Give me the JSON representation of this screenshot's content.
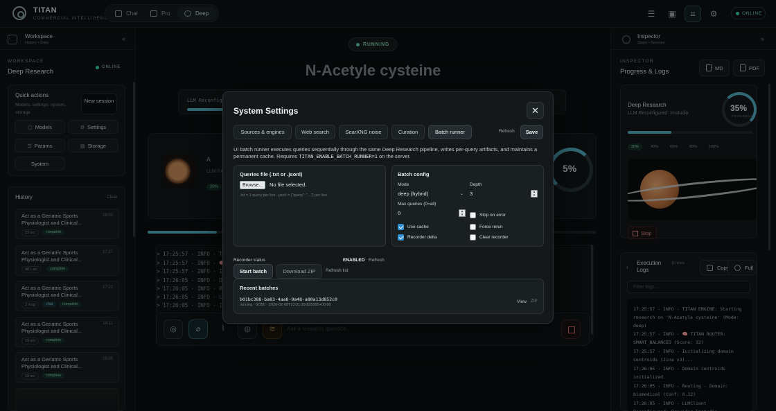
{
  "topbar": {
    "brand": "TITAN",
    "brand_sub": "COMMERCIAL INTELLIGENCE",
    "modes": [
      "Chat",
      "Pro",
      "Deep"
    ],
    "status": "ONLINE"
  },
  "workspace": {
    "title": "Workspace",
    "sub": "History • Data",
    "label": "WORKSPACE",
    "name": "Deep Research",
    "status": "ONLINE",
    "quick_actions": {
      "title": "Quick actions",
      "sub": "Models, settings, system, storage",
      "new_session": "New session",
      "buttons": [
        "Models",
        "Settings",
        "Params",
        "Storage",
        "System"
      ]
    },
    "history": {
      "title": "History",
      "clear": "Clear",
      "items": [
        {
          "title": "Act as a Geriatric Sports Physiologist and Clinical...",
          "time": "18:00",
          "badge": "19 src",
          "status": "complete"
        },
        {
          "title": "Act as a Geriatric Sports Physiologist and Clinical...",
          "time": "17:27",
          "badge": "481 src",
          "status": "complete"
        },
        {
          "title": "Act as a Geriatric Sports Physiologist and Clinical...",
          "time": "17:23",
          "badge": "2 msg",
          "tag": "chat",
          "status": "complete"
        },
        {
          "title": "Act as a Geriatric Sports Physiologist and Clinical...",
          "time": "16:11",
          "badge": "19 src",
          "status": "complete"
        },
        {
          "title": "Act as a Geriatric Sports Physiologist and Clinical...",
          "time": "16:05",
          "badge": "19 src",
          "status": "complete"
        }
      ]
    }
  },
  "center": {
    "status": "RUNNING",
    "title": "N-Acetyle cysteine",
    "card1_text": "LLM Reconfigured",
    "card2_title": "A",
    "card2_sub": "LLM Re",
    "card2_chip": "20%",
    "ring_pct": "5%",
    "log_lines": [
      "> 17:25:57 - INFO - TI",
      "> 17:25:57 - INFO - 🧠",
      "> 17:25:57 - INFO - In",
      "> 17:26:05 - INFO - Do",
      "> 17:26:05 - INFO - Ro",
      "> 17:26:05 - INFO - LL",
      "> 17:26:05 - INFO - [D"
    ],
    "input_placeholder": "Ask a research question..."
  },
  "inspector": {
    "title": "Inspector",
    "sub": "Steps • Sources",
    "label": "INSPECTOR",
    "name": "Progress & Logs",
    "export_md": "MD",
    "export_pdf": "PDF",
    "progress": {
      "title": "Deep Research",
      "sub": "LLM Reconfigured: Imstudio",
      "pct": "35%",
      "pct_label": "PROGRESS",
      "value": 0.35,
      "chips": [
        "20%",
        "40%",
        "60%",
        "80%",
        "100%"
      ],
      "stop": "Stop"
    },
    "exec": {
      "title": "Execution Logs",
      "lines_count": "15 lines",
      "copy": "Copy",
      "full": "Full",
      "filter_placeholder": "Filter logs...",
      "lines": [
        "17:25:57 - INFO - TITAN ENGINE: Starting research on 'N-Acetyle cysteine' (Mode: deep)",
        "17:25:57 - INFO - 🧠 TITAN ROUTER: SMART_BALANCED (Score: 32)",
        "17:25:57 - INFO - Initializing domain centroids (Jina v3)...",
        "17:26:05 - INFO - Domain centroids initialized.",
        "17:26:05 - INFO - Routing - Domain: biomedical (Conf: 0.32)",
        "17:26:05 - INFO - LLMClient Reconfigured: Provider=lmstudio"
      ]
    }
  },
  "modal": {
    "title": "System Settings",
    "tabs": [
      "Sources & engines",
      "Web search",
      "SearXNG noise",
      "Curation",
      "Batch runner"
    ],
    "refresh": "Refresh",
    "save": "Save",
    "desc": "UI batch runner executes queries sequentially through the same Deep Research pipeline, writes per-query artifacts, and maintains a permanent cache. Requires",
    "desc_code": "TITAN_ENABLE_BATCH_RUNNER=1",
    "desc_tail": "on the server.",
    "queries": {
      "title": "Queries file (.txt or .jsonl)",
      "browse": "Browse...",
      "no_file": "No file selected.",
      "hint": ".txt = 1 query per line. .jsonl = {\"query\": \"...\"} per line."
    },
    "batch": {
      "title": "Batch config",
      "mode_label": "Mode",
      "mode_value": "deep (hybrid)",
      "depth_label": "Depth",
      "depth_value": "3",
      "max_label": "Max queries (0=all)",
      "max_value": "0",
      "checks": [
        {
          "label": "Use cache",
          "checked": true
        },
        {
          "label": "Recorder delta",
          "checked": true
        },
        {
          "label": "Stop on error",
          "checked": false
        },
        {
          "label": "Force rerun",
          "checked": false
        },
        {
          "label": "Clear recorder",
          "checked": false
        }
      ]
    },
    "recorder": {
      "label": "Recorder status",
      "status": "ENABLED",
      "refresh": "Refresh",
      "start": "Start batch",
      "download": "Download ZIP",
      "refresh_list": "Refresh list"
    },
    "recent": {
      "title": "Recent batches",
      "id": "b01bc388-ba83-4aa8-9a48-a80a13d852c0",
      "meta": "running · 0/250 · 2026-02-08T13:31:29.825995+00:00",
      "view": "View",
      "zip": "ZIP"
    }
  }
}
